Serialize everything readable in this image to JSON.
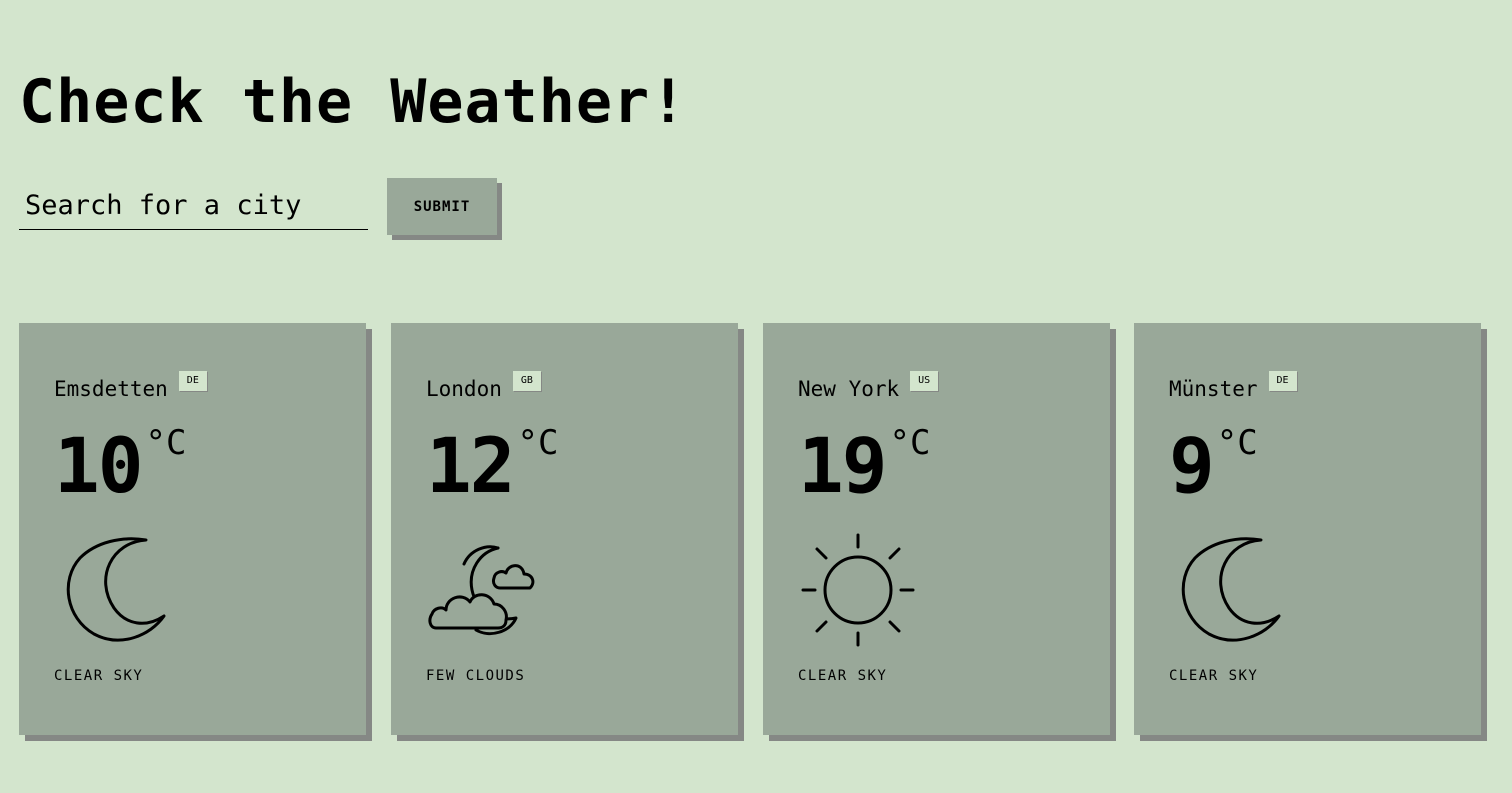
{
  "page": {
    "title": "Check the Weather!"
  },
  "search": {
    "placeholder": "Search for a city",
    "value": "",
    "submit_label": "SUBMIT"
  },
  "unit": "°C",
  "cards": [
    {
      "city": "Emsdetten",
      "country": "DE",
      "temp": "10",
      "icon": "moon-icon",
      "description": "CLEAR SKY"
    },
    {
      "city": "London",
      "country": "GB",
      "temp": "12",
      "icon": "moon-cloud-icon",
      "description": "FEW CLOUDS"
    },
    {
      "city": "New York",
      "country": "US",
      "temp": "19",
      "icon": "sun-icon",
      "description": "CLEAR SKY"
    },
    {
      "city": "Münster",
      "country": "DE",
      "temp": "9",
      "icon": "moon-icon",
      "description": "CLEAR SKY"
    }
  ],
  "colors": {
    "background": "#d3e5cd",
    "card": "#99a899",
    "shadow": "#858885",
    "text": "#000000"
  }
}
